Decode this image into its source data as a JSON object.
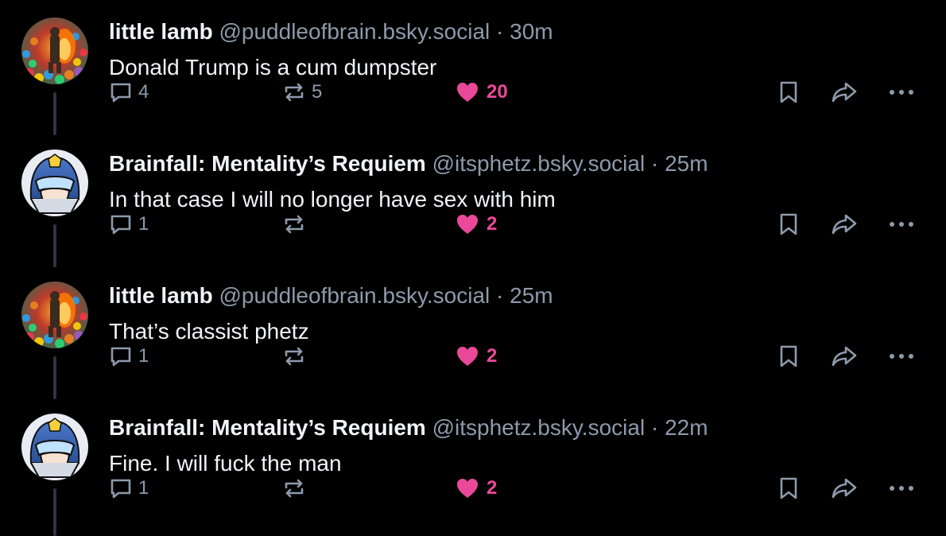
{
  "thread": {
    "posts": [
      {
        "author": "little lamb",
        "handle": "@puddleofbrain.bsky.social",
        "separator": "·",
        "time": "30m",
        "text": "Donald Trump is a cum dumpster",
        "reply_count": "4",
        "repost_count": "5",
        "like_count": "20",
        "liked": true,
        "avatar": "lamb-avatar"
      },
      {
        "author": "Brainfall: Mentality’s Requiem",
        "handle": "@itsphetz.bsky.social",
        "separator": "·",
        "time": "25m",
        "text": "In that case I will no longer have sex with him",
        "reply_count": "1",
        "repost_count": "",
        "like_count": "2",
        "liked": true,
        "avatar": "helmet-avatar"
      },
      {
        "author": "little lamb",
        "handle": "@puddleofbrain.bsky.social",
        "separator": "·",
        "time": "25m",
        "text": "That’s classist phetz",
        "reply_count": "1",
        "repost_count": "",
        "like_count": "2",
        "liked": true,
        "avatar": "lamb-avatar"
      },
      {
        "author": "Brainfall: Mentality’s Requiem",
        "handle": "@itsphetz.bsky.social",
        "separator": "·",
        "time": "22m",
        "text": "Fine. I will fuck the man",
        "reply_count": "1",
        "repost_count": "",
        "like_count": "2",
        "liked": true,
        "avatar": "helmet-avatar"
      }
    ]
  },
  "icons": {
    "reply": "speech-bubble-icon",
    "repost": "repost-arrows-icon",
    "like": "heart-icon",
    "bookmark": "bookmark-icon",
    "share": "share-arrow-icon",
    "more": "ellipsis-icon"
  },
  "colors": {
    "background": "#000000",
    "text": "#f1f3f5",
    "muted": "#8d9aab",
    "like": "#ec4899",
    "thread_line": "#2e3440"
  }
}
